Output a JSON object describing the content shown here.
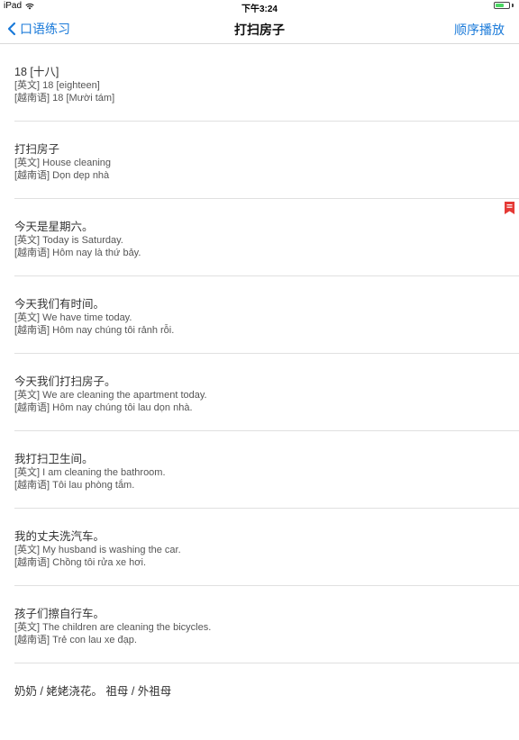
{
  "status_bar": {
    "device": "iPad",
    "time": "下午3:24"
  },
  "nav": {
    "back_label": "口语练习",
    "title": "打扫房子",
    "right_label": "顺序播放"
  },
  "colors": {
    "accent": "#1a7ad9",
    "bookmark": "#e53935",
    "battery": "#4cd964"
  },
  "icons": {
    "wifi": "wifi-icon",
    "battery": "battery-icon",
    "back": "chevron-left-icon",
    "bookmark": "bookmark-icon"
  },
  "items": [
    {
      "zh": "18 [十八]",
      "en": "[英文] 18 [eighteen]",
      "vi": "[越南语] 18 [Mười tám]"
    },
    {
      "zh": "打扫房子",
      "en": "[英文] House cleaning",
      "vi": "[越南语] Dọn dẹp nhà"
    },
    {
      "zh": "今天是星期六。",
      "en": "[英文] Today is Saturday.",
      "vi": "[越南语] Hôm nay là thứ bảy."
    },
    {
      "zh": "今天我们有时间。",
      "en": "[英文] We have time today.",
      "vi": "[越南语] Hôm nay chúng tôi rảnh rỗi."
    },
    {
      "zh": "今天我们打扫房子。",
      "en": "[英文] We are cleaning the apartment today.",
      "vi": "[越南语] Hôm nay chúng tôi lau dọn nhà."
    },
    {
      "zh": "我打扫卫生间。",
      "en": "[英文] I am cleaning the bathroom.",
      "vi": "[越南语] Tôi lau phòng tắm."
    },
    {
      "zh": "我的丈夫洗汽车。",
      "en": "[英文] My husband is washing the car.",
      "vi": "[越南语] Chồng tôi rửa xe hơi."
    },
    {
      "zh": "孩子们擦自行车。",
      "en": "[英文] The children are cleaning the bicycles.",
      "vi": "[越南语] Trẻ con lau xe đạp."
    },
    {
      "zh": "奶奶 / 姥姥浇花。 祖母 / 外祖母",
      "en": "",
      "vi": ""
    }
  ]
}
